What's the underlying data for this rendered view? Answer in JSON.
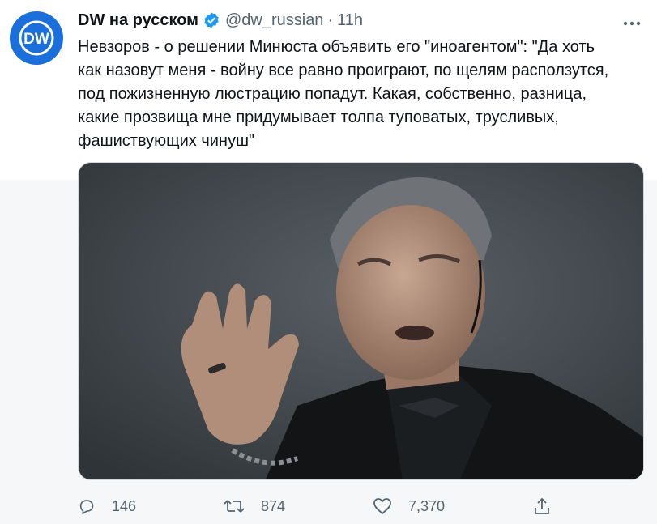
{
  "tweet": {
    "display_name": "DW на русском",
    "handle": "@dw_russian",
    "separator": "·",
    "time": "11h",
    "avatar_text": "DW",
    "text": "Невзоров - о решении Минюста объявить его \"иноагентом\": \"Да хоть\nкак назовут меня - войну все равно проиграют, по щелям расползутся,\nпод пожизненную люстрацию попадут. Какая, собственно, разница,\nкакие прозвища мне придумывает толпа туповатых, трусливых,\nфашиствующих чинуш\""
  },
  "actions": {
    "replies": "146",
    "retweets": "874",
    "likes": "7,370"
  },
  "colors": {
    "brand_blue": "#1a6fdb",
    "verified_blue": "#1d9bf0",
    "secondary_text": "#536471"
  }
}
